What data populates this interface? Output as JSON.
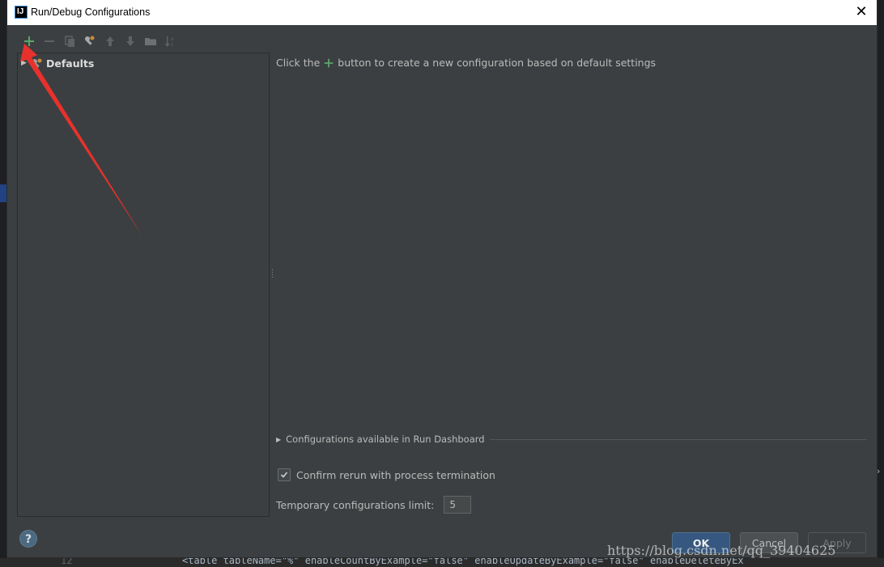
{
  "window": {
    "title": "Run/Debug Configurations",
    "app_icon_text": "IJ"
  },
  "toolbar": {
    "items": [
      {
        "name": "add",
        "icon": "plus-icon"
      },
      {
        "name": "remove",
        "icon": "minus-icon"
      },
      {
        "name": "copy",
        "icon": "copy-icon"
      },
      {
        "name": "edit-defaults",
        "icon": "wrench-icon"
      },
      {
        "name": "move-up",
        "icon": "arrow-up-icon"
      },
      {
        "name": "move-down",
        "icon": "arrow-down-icon"
      },
      {
        "name": "folder",
        "icon": "folder-icon"
      },
      {
        "name": "sort",
        "icon": "sort-icon"
      }
    ]
  },
  "tree": {
    "defaults_label": "Defaults"
  },
  "main": {
    "hint_before": "Click the",
    "hint_after": "button to create a new configuration based on default settings",
    "dashboard_label": "Configurations available in Run Dashboard",
    "confirm_label": "Confirm rerun with process termination",
    "confirm_checked": true,
    "temp_limit_label": "Temporary configurations limit:",
    "temp_limit_value": "5"
  },
  "buttons": {
    "help": "?",
    "ok": "OK",
    "cancel": "Cancel",
    "apply": "Apply"
  },
  "watermark": "https://blog.csdn.net/qq_39404625",
  "background_code": {
    "line_number": "12",
    "code": "<table tableName=\"%\" enableCountByExample=\"false\" enableUpdateByExample=\"false\" enableDeleteByEx"
  },
  "colors": {
    "accent_green": "#59a869",
    "annotation_red": "#e8312c",
    "ok_button": "#365880"
  }
}
